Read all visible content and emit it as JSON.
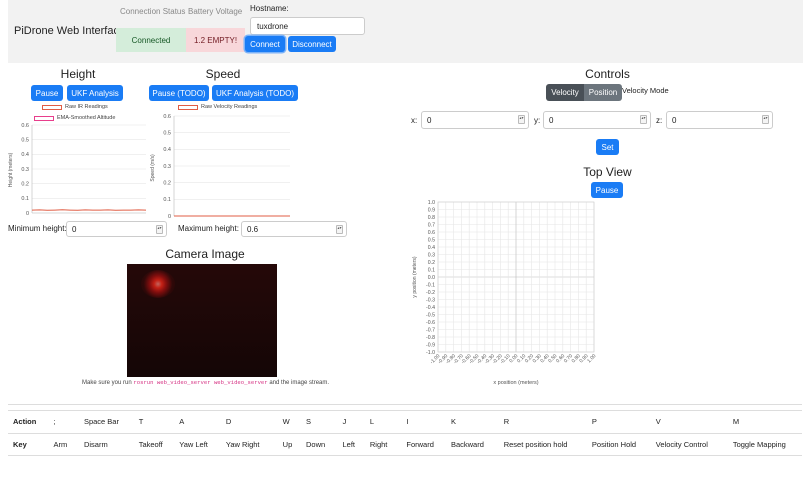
{
  "app": {
    "title": "PiDrone Web Interface"
  },
  "header": {
    "connection_status_label": "Connection Status",
    "connection_status_value": "Connected",
    "battery_label": "Battery Voltage",
    "battery_value": "1.2 EMPTY!",
    "hostname_label": "Hostname:",
    "hostname_value": "tuxdrone",
    "connect_label": "Connect",
    "disconnect_label": "Disconnect",
    "colors": {
      "connected_bg": "#d4edda",
      "battery_bg": "#f8d7da",
      "primary": "#1a7cf5"
    }
  },
  "height": {
    "title": "Height",
    "pause_label": "Pause",
    "ukf_label": "UKF Analysis",
    "legend": [
      "Raw IR Readings",
      "EMA-Smoothed Altitude"
    ],
    "min_label": "Minimum height:",
    "min_value": "0"
  },
  "speed": {
    "title": "Speed",
    "pause_label": "Pause (TODO)",
    "ukf_label": "UKF Analysis (TODO)",
    "legend": [
      "Raw Velocity Readings"
    ],
    "max_label": "Maximum height:",
    "max_value": "0.6"
  },
  "camera": {
    "title": "Camera Image",
    "note_prefix": "Make sure you run",
    "note_code": "rosrun web_video_server web_video_server",
    "note_suffix": "and the image stream."
  },
  "controls": {
    "title": "Controls",
    "mode_buttons": [
      "Velocity",
      "Position"
    ],
    "mode_label": "Velocity Mode",
    "x_label": "x:",
    "x_value": "0",
    "y_label": "y:",
    "y_value": "0",
    "z_label": "z:",
    "z_value": "0",
    "set_label": "Set"
  },
  "top_view": {
    "title": "Top View",
    "pause_label": "Pause"
  },
  "keymap": {
    "action_header": "Action",
    "key_header": "Key",
    "keys": [
      ";",
      "Space Bar",
      "T",
      "A",
      "D",
      "W",
      "S",
      "J",
      "L",
      "I",
      "K",
      "R",
      "P",
      "V",
      "M"
    ],
    "actions": [
      "Arm",
      "Disarm",
      "Takeoff",
      "Yaw Left",
      "Yaw Right",
      "Up",
      "Down",
      "Left",
      "Right",
      "Forward",
      "Backward",
      "Reset position hold",
      "Position Hold",
      "Velocity Control",
      "Toggle Mapping"
    ]
  },
  "chart_data": [
    {
      "type": "line",
      "ylabel": "Height (meters)",
      "ylim": [
        0,
        0.6
      ],
      "yticks": [
        "0.6",
        "0.5",
        "0.4",
        "0.3",
        "0.2",
        "0.1",
        "0"
      ],
      "series": [
        {
          "name": "Raw IR Readings",
          "color": "#e05d44",
          "values": [
            0.02,
            0.021,
            0.019,
            0.02,
            0.022,
            0.02,
            0.019,
            0.021,
            0.02,
            0.02,
            0.021,
            0.019,
            0.02,
            0.02,
            0.021,
            0.02
          ]
        },
        {
          "name": "EMA-Smoothed Altitude",
          "color": "#e83e8c",
          "values": []
        }
      ],
      "grid": true,
      "legend": "top"
    },
    {
      "type": "line",
      "ylabel": "Speed (m/s)",
      "ylim": [
        0,
        0.6
      ],
      "yticks": [
        "0.6",
        "0.5",
        "0.4",
        "0.3",
        "0.2",
        "0.1",
        "0"
      ],
      "series": [
        {
          "name": "Raw Velocity Readings",
          "color": "#e05d44",
          "values": [
            0,
            0,
            0,
            0,
            0,
            0,
            0,
            0
          ]
        }
      ],
      "grid": true,
      "legend": "top"
    },
    {
      "type": "scatter",
      "xlabel": "x position (meters)",
      "ylabel": "y position (meters)",
      "xlim": [
        -1.0,
        1.0
      ],
      "ylim": [
        -1.0,
        1.0
      ],
      "xticks": [
        "-1.00",
        "-0.90",
        "-0.80",
        "-0.70",
        "-0.60",
        "-0.50",
        "-0.40",
        "-0.30",
        "-0.20",
        "-0.10",
        "0.00",
        "0.10",
        "0.20",
        "0.30",
        "0.40",
        "0.50",
        "0.60",
        "0.70",
        "0.80",
        "0.90",
        "1.00"
      ],
      "yticks": [
        "1.0",
        "0.9",
        "0.8",
        "0.7",
        "0.6",
        "0.5",
        "0.4",
        "0.3",
        "0.2",
        "0.1",
        "0.0",
        "-0.1",
        "-0.2",
        "-0.3",
        "-0.4",
        "-0.5",
        "-0.6",
        "-0.7",
        "-0.8",
        "-0.9",
        "-1.0"
      ],
      "points": [],
      "grid": true
    }
  ]
}
